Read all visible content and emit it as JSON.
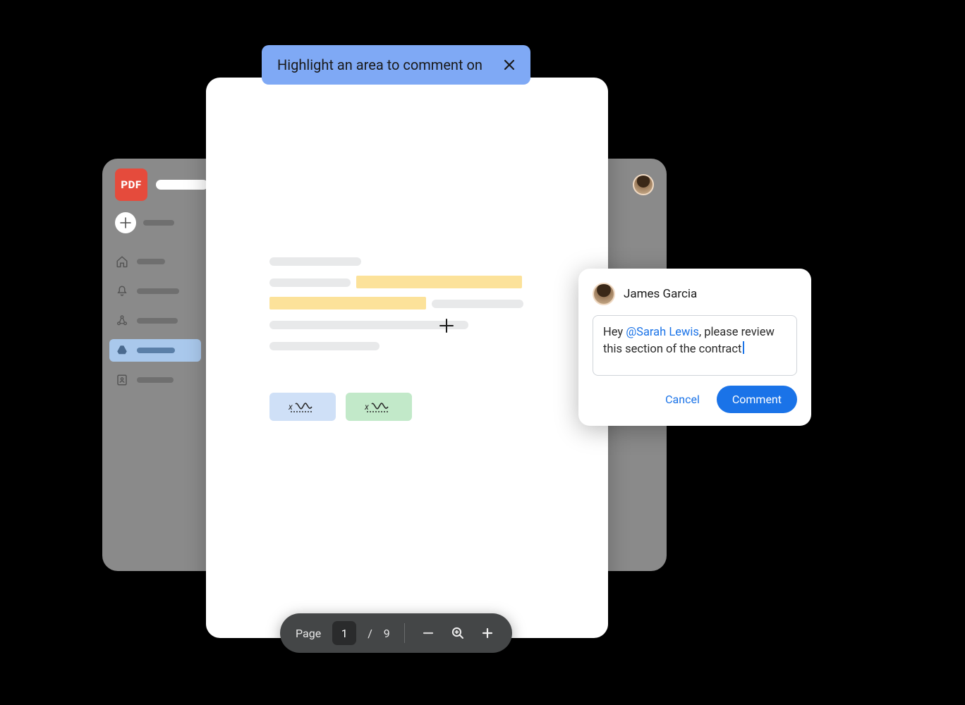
{
  "app": {
    "pdf_badge": "PDF"
  },
  "tooltip": {
    "text": "Highlight an area to comment on"
  },
  "comment": {
    "author": "James Garcia",
    "text_pre": "Hey ",
    "mention": "@Sarah Lewis",
    "text_post": ", please review this section of the contract",
    "cancel_label": "Cancel",
    "submit_label": "Comment"
  },
  "pager": {
    "page_label": "Page",
    "current": "1",
    "separator": "/",
    "total": "9"
  },
  "signature_glyph": "x",
  "icons": {
    "home": "home-icon",
    "bell": "bell-icon",
    "share": "share-icon",
    "drive": "drive-icon",
    "contacts": "contacts-icon"
  },
  "colors": {
    "accent": "#1a73e8",
    "highlight": "#fce29a",
    "tooltip_bg": "#7fa9f5",
    "pdf_red": "#e54b3c"
  }
}
